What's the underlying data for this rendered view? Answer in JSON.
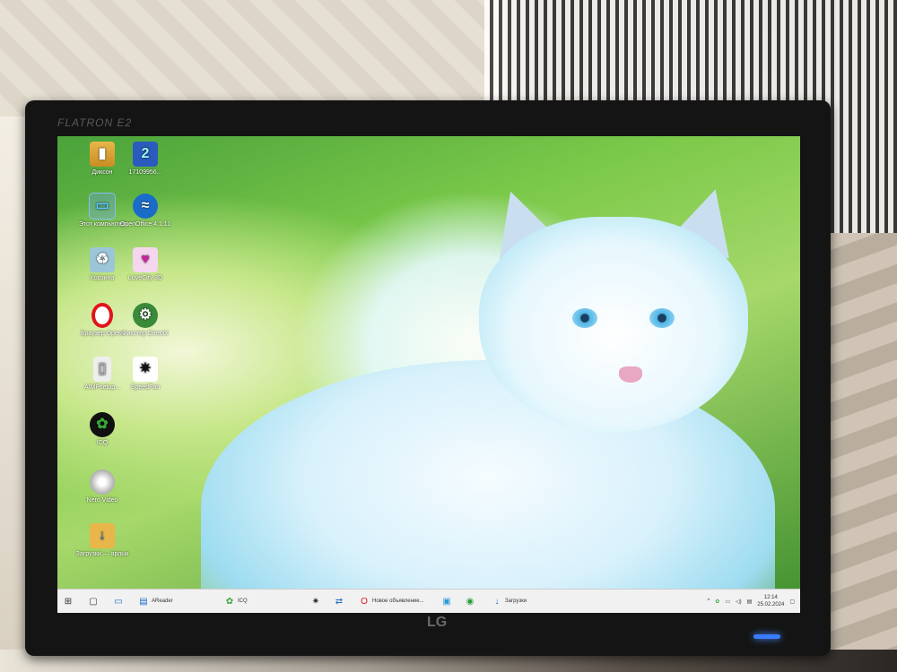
{
  "monitor": {
    "model_label": "FLATRON E2",
    "brand": "LG"
  },
  "desktop_icons": [
    {
      "label": "Диксон",
      "icon": "folder-icon"
    },
    {
      "label": "17109956...",
      "icon": "app-icon"
    },
    {
      "label": "Этот компьютер",
      "icon": "computer-icon"
    },
    {
      "label": "OpenOffice 4.1.11",
      "icon": "openoffice-icon"
    },
    {
      "label": "Корзина",
      "icon": "recycle-bin-icon"
    },
    {
      "label": "LoveCity 3D",
      "icon": "lovecity-icon"
    },
    {
      "label": "Браузер Opera",
      "icon": "opera-icon"
    },
    {
      "label": "Фикстер DirectX",
      "icon": "fixer-icon"
    },
    {
      "label": "AIMPsetup...",
      "icon": "file-icon"
    },
    {
      "label": "SpeedFan",
      "icon": "speedfan-icon"
    },
    {
      "label": "ICQ",
      "icon": "icq-icon"
    },
    {
      "label": "Nero Video",
      "icon": "disc-icon"
    },
    {
      "label": "Загрузки — ярлык",
      "icon": "downloads-icon"
    }
  ],
  "taskbar": {
    "items": [
      {
        "label": "AReader",
        "icon": "reader-icon"
      },
      {
        "label": "ICQ",
        "icon": "icq-icon"
      },
      {
        "label": "",
        "icon": "speedfan-icon"
      },
      {
        "label": "",
        "icon": "network-icon"
      },
      {
        "label": "Новое объявление...",
        "icon": "opera-icon"
      },
      {
        "label": "",
        "icon": "screen-icon"
      },
      {
        "label": "",
        "icon": "whatsapp-icon"
      },
      {
        "label": "Загрузки",
        "icon": "downloads-icon"
      }
    ],
    "time": "12:14",
    "date": "25.02.2024"
  },
  "colors": {
    "opera_red": "#e0151b",
    "openoffice_blue": "#1b6cc9",
    "icq_green": "#3aa53a",
    "led_blue": "#3a7bff"
  }
}
